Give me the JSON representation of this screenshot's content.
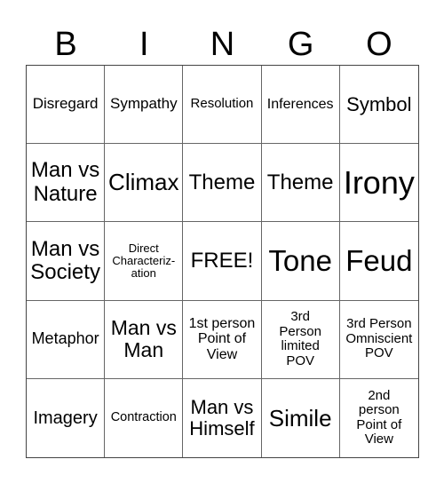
{
  "header": {
    "letters": [
      "B",
      "I",
      "N",
      "G",
      "O"
    ]
  },
  "cells": [
    "Disregard",
    "Sympathy",
    "Resolution",
    "Inferences",
    "Symbol",
    "Man vs\nNature",
    "Climax",
    "Theme",
    "Theme",
    "Irony",
    "Man vs\nSociety",
    "Direct\nCharacteriz-\nation",
    "FREE!",
    "Tone",
    "Feud",
    "Metaphor",
    "Man vs\nMan",
    "1st person\nPoint of\nView",
    "3rd\nPerson\nlimited\nPOV",
    "3rd Person\nOmniscient\nPOV",
    "Imagery",
    "Contraction",
    "Man vs\nHimself",
    "Simile",
    "2nd\nperson\nPoint of\nView"
  ]
}
